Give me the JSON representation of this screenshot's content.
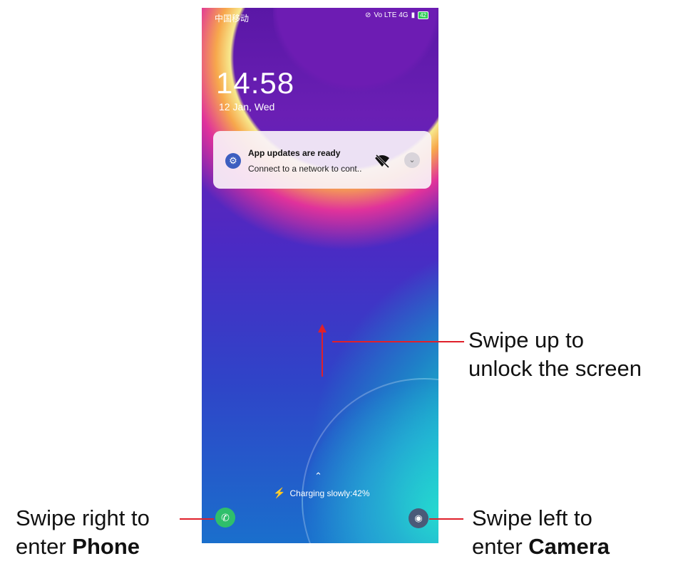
{
  "statusbar": {
    "carrier": "中国移动",
    "network": "Vo LTE 4G",
    "battery": "42"
  },
  "lock": {
    "time": "14:58",
    "date": "12 Jan, Wed"
  },
  "notification": {
    "title": "App updates are ready",
    "text": "Connect to a network to cont..",
    "expand": "⌄"
  },
  "bottom": {
    "up_hint": "⌃",
    "charging": "Charging slowly:42%"
  },
  "callouts": {
    "unlock_line1": "Swipe up to",
    "unlock_line2": "unlock the screen",
    "phone_line1": "Swipe right to",
    "phone_line2_prefix": "enter ",
    "phone_line2_bold": "Phone",
    "camera_line1": "Swipe left to",
    "camera_line2_prefix": "enter ",
    "camera_line2_bold": "Camera"
  },
  "colors": {
    "annotation": "#e0202a",
    "phone_button": "#2fbf6b",
    "camera_button": "#4a5a78"
  }
}
